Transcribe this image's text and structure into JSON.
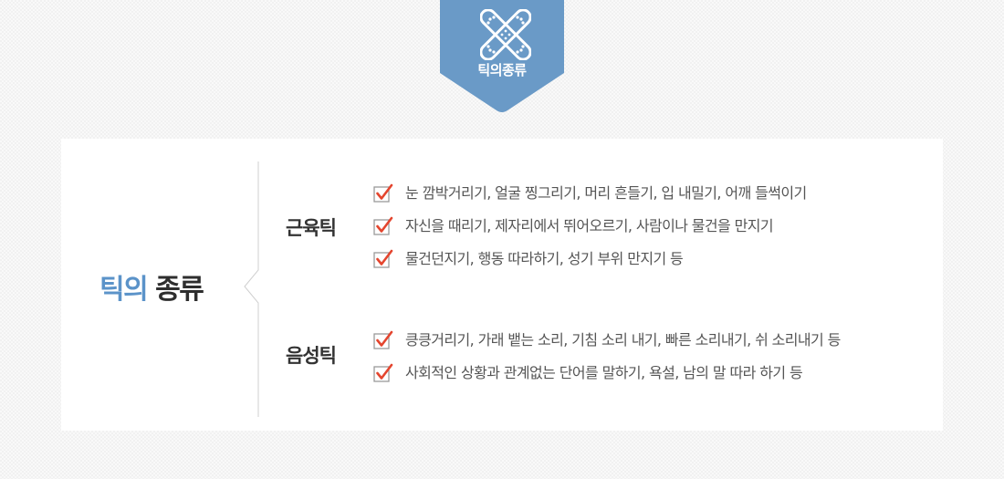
{
  "badge": {
    "label": "틱의종류",
    "icon": "bandage-icon"
  },
  "colors": {
    "accent_blue": "#5b93c9",
    "badge_blue": "#6a9ac7",
    "check_red": "#e4452e",
    "text": "#555555"
  },
  "title": {
    "accent": "틱의",
    "rest": " 종류"
  },
  "sections": [
    {
      "name": "근육틱",
      "items": [
        "눈 깜박거리기, 얼굴 찡그리기, 머리 흔들기, 입 내밀기, 어깨 들썩이기",
        "자신을 때리기, 제자리에서 뛰어오르기, 사람이나 물건을 만지기",
        "물건던지기, 행동 따라하기, 성기 부위 만지기 등"
      ]
    },
    {
      "name": "음성틱",
      "items": [
        "킁킁거리기, 가래 뱉는 소리, 기침 소리 내기, 빠른 소리내기, 쉬 소리내기 등",
        "사회적인 상황과 관계없는 단어를 말하기, 욕설, 남의 말 따라 하기 등"
      ]
    }
  ]
}
